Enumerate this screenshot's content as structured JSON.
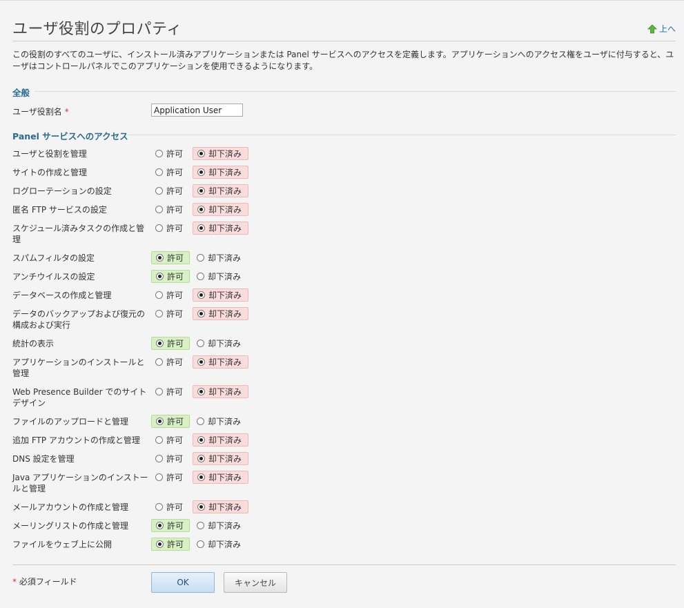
{
  "page": {
    "title": "ユーザ役割のプロパティ",
    "up_link": "上へ",
    "description": "この役割のすべてのユーザに、インストール済みアプリケーションまたは Panel サービスへのアクセスを定義します。アプリケーションへのアクセス権をユーザに付与すると、ユーザはコントロールパネルでこのアプリケーションを使用できるようになります。"
  },
  "general": {
    "heading": "全般",
    "role_name_label": "ユーザ役割名",
    "required_mark": "*",
    "role_name_value": "Application User"
  },
  "services": {
    "heading": "Panel サービスへのアクセス",
    "allow_label": "許可",
    "deny_label": "却下済み",
    "items": [
      {
        "label": "ユーザと役割を管理",
        "selected": "deny"
      },
      {
        "label": "サイトの作成と管理",
        "selected": "deny"
      },
      {
        "label": "ログローテーションの設定",
        "selected": "deny"
      },
      {
        "label": "匿名 FTP サービスの設定",
        "selected": "deny"
      },
      {
        "label": "スケジュール済みタスクの作成と管理",
        "selected": "deny"
      },
      {
        "label": "スパムフィルタの設定",
        "selected": "allow"
      },
      {
        "label": "アンチウイルスの設定",
        "selected": "allow"
      },
      {
        "label": "データベースの作成と管理",
        "selected": "deny"
      },
      {
        "label": "データのバックアップおよび復元の構成および実行",
        "selected": "deny"
      },
      {
        "label": "統計の表示",
        "selected": "allow"
      },
      {
        "label": "アプリケーションのインストールと管理",
        "selected": "deny"
      },
      {
        "label": "Web Presence Builder でのサイトデザイン",
        "selected": "deny"
      },
      {
        "label": "ファイルのアップロードと管理",
        "selected": "allow"
      },
      {
        "label": "追加 FTP アカウントの作成と管理",
        "selected": "deny"
      },
      {
        "label": "DNS 設定を管理",
        "selected": "deny"
      },
      {
        "label": "Java アプリケーションのインストールと管理",
        "selected": "deny"
      },
      {
        "label": "メールアカウントの作成と管理",
        "selected": "deny"
      },
      {
        "label": "メーリングリストの作成と管理",
        "selected": "allow"
      },
      {
        "label": "ファイルをウェブ上に公開",
        "selected": "allow"
      }
    ]
  },
  "footer": {
    "required_note_mark": "*",
    "required_note": "必須フィールド",
    "ok_label": "OK",
    "cancel_label": "キャンセル"
  },
  "colors": {
    "heading": "#2a6a8e",
    "allow_highlight": "#d7f0c4",
    "deny_highlight": "#fbdcdc",
    "link": "#1a6fb0"
  },
  "icons": {
    "up": "green-up-arrow-icon"
  }
}
